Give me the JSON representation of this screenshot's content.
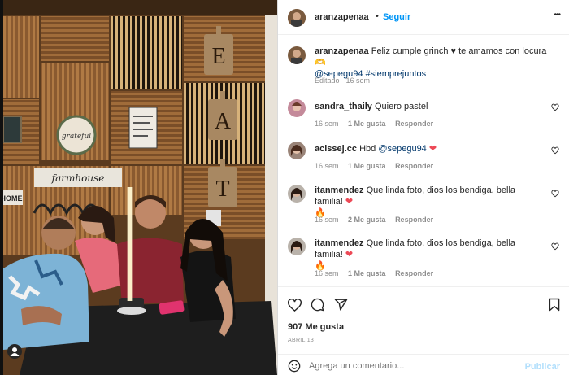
{
  "post": {
    "author": "aranzapenaa",
    "follow_label": "Seguir",
    "separator": "•",
    "more_label": "•••"
  },
  "caption": {
    "username": "aranzapenaa",
    "text": "Feliz cumple grinch ♥ te amamos con locura 🫶",
    "mention": "@sepegu94",
    "hashtag": "#siemprejuntos",
    "meta": "Editado · 16 sem"
  },
  "comments": [
    {
      "username": "sandra_thaily",
      "text": "Quiero pastel",
      "emoji": "",
      "time": "16 sem",
      "likes": "1 Me gusta",
      "reply": "Responder"
    },
    {
      "username": "acissej.cc",
      "text": "Hbd",
      "mention": "@sepegu94",
      "emoji": "❤",
      "time": "16 sem",
      "likes": "1 Me gusta",
      "reply": "Responder"
    },
    {
      "username": "itanmendez",
      "text": "Que linda foto, dios los bendiga, bella familia!",
      "emoji": "❤",
      "emoji2": "🔥",
      "time": "16 sem",
      "likes": "2 Me gusta",
      "reply": "Responder"
    },
    {
      "username": "itanmendez",
      "text": "Que linda foto, dios los bendiga, bella familia!",
      "emoji": "❤",
      "emoji2": "🔥",
      "time": "16 sem",
      "likes": "1 Me gusta",
      "reply": "Responder"
    }
  ],
  "stats": {
    "likes": "907 Me gusta",
    "date": "ABRIL 13"
  },
  "composer": {
    "placeholder": "Agrega un comentario...",
    "post_label": "Publicar"
  },
  "photo": {
    "sign_letters": [
      "E",
      "A",
      "T"
    ],
    "farmhouse_sign": "farmhouse",
    "home_sign": "HOME",
    "wreath_text": "grateful"
  },
  "colors": {
    "follow": "#0095f6",
    "link": "#00376b",
    "muted": "#8e8e8e",
    "heart_red": "#ed4956",
    "publish_disabled": "#b2dffc"
  }
}
